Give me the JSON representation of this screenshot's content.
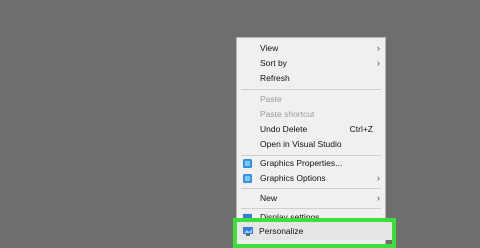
{
  "context_menu": {
    "items": [
      {
        "label": "View",
        "has_submenu": true,
        "disabled": false
      },
      {
        "label": "Sort by",
        "has_submenu": true,
        "disabled": false
      },
      {
        "label": "Refresh",
        "has_submenu": false,
        "disabled": false
      },
      {
        "label": "Paste",
        "has_submenu": false,
        "disabled": true
      },
      {
        "label": "Paste shortcut",
        "has_submenu": false,
        "disabled": true
      },
      {
        "label": "Undo Delete",
        "shortcut": "Ctrl+Z",
        "has_submenu": false,
        "disabled": false
      },
      {
        "label": "Open in Visual Studio",
        "has_submenu": false,
        "disabled": false
      },
      {
        "label": "Graphics Properties...",
        "icon": "intel-graphics-icon",
        "has_submenu": false,
        "disabled": false
      },
      {
        "label": "Graphics Options",
        "icon": "intel-graphics-icon",
        "has_submenu": true,
        "disabled": false
      },
      {
        "label": "New",
        "has_submenu": true,
        "disabled": false
      },
      {
        "label": "Display settings",
        "icon": "display-icon",
        "has_submenu": false,
        "disabled": false
      },
      {
        "label": "Personalize",
        "icon": "personalize-icon",
        "has_submenu": false,
        "disabled": false
      }
    ],
    "submenu_arrow": "›"
  },
  "highlight": {
    "target": "Personalize",
    "color": "#3ce03c"
  },
  "colors": {
    "desktop_bg": "#6e6e6e",
    "menu_bg": "#f0f0f0",
    "disabled_text": "#9a9a9a",
    "icon_blue": "#3a7bd5"
  }
}
